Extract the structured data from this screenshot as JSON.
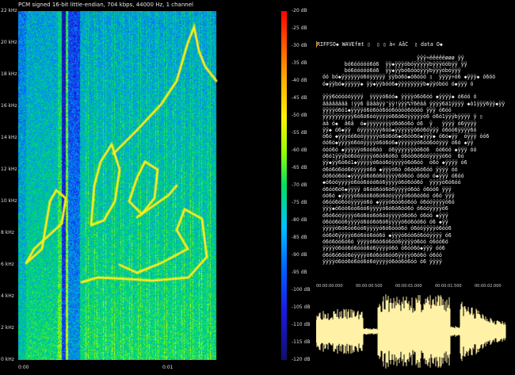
{
  "spectrogram": {
    "title": "PCM signed 16-bit little-endian, 704 kbps, 44000 Hz, 1 channel",
    "y_ticks": [
      "22 kHz",
      "20 kHz",
      "18 kHz",
      "16 kHz",
      "14 kHz",
      "12 kHz",
      "10 kHz",
      "8 kHz",
      "6 kHz",
      "4 kHz",
      "2 kHz",
      "0 kHz"
    ],
    "x_ticks": [
      "0:00",
      "0:01"
    ],
    "db_ticks": [
      "-20 dB",
      "-25 dB",
      "-30 dB",
      "-35 dB",
      "-40 dB",
      "-45 dB",
      "-50 dB",
      "-55 dB",
      "-60 dB",
      "-65 dB",
      "-70 dB",
      "-75 dB",
      "-80 dB",
      "-85 dB",
      "-90 dB",
      "-95 dB",
      "-100 dB",
      "-105 dB",
      "-110 dB",
      "-115 dB",
      "-120 dB"
    ],
    "colors": {
      "loud": "#ffff00",
      "mid": "#00e060",
      "quiet": "#1a1ae0"
    }
  },
  "hex_view": {
    "lines": [
      "RIFFŠÕ◆ WAVEfmt ▯  ▯ ▯ à« ÀåĈ  ▯ data Õ◆",
      "",
      "                                ÿÿÿ÷ëêéêëøøø ÿÿ",
      "         bó6óóóóó6ó6  ÿÿ◆ÿÿÿóbóÿÿÿÿÿbÿÿÿóóbÿÿ ÿÿ",
      "         bó6óóóóó6ó6  ÿÿ◆ÿÿbó6óòóÿÿÿbÿÿÿóbóÿÿÿ",
      "  óó bó◆ÿÿÿÿÿÿó6óÿÿÿÿÿ ÿÿbó6ó◆ó6óóó ▯  ÿÿÿÿ÷ó6 ◆ÿÿÿ◆ ó6óó",
      "  ó◆ÿÿbó◆ÿÿÿÿÿ◆ ÿÿ◆ÿÿbóó6◆ÿÿÿÿÿÿÿÿb◆ÿÿóbóó ó◆ÿÿÿ ó",
      "",
      "  ÿÿÿ6óóóóóÿÿÿÿ  ÿÿÿÿó6óó◆ ÿÿÿÿó6ó6óó ◆ÿÿÿÿ◆ ó6óó ó",
      "  ââââââââ (ÿÿ6 Ùâââÿÿ'ÿÿ!ÿÿÿ%Ÿ6ëäâ ÿÿÿÿ6ä1ÿÿÿÿ ◆ò1ÿÿÿ6ÿÿ◆ÿÿ",
      "  ÿÿÿÿó6ó1◆ÿÿÿÿó6ò6óó6óó6óóóó6óóóó ÿÿÿ ó6óó",
      "  ÿÿÿÿÿÿÿÿÿÿ6ó6ó6óóÿÿÿÿó66ó6óÿÿÿÿÿó6 ó6ó1ÿÿÿbÿÿÿÿ ÿ ▯",
      "  àâ ó◆  â6â  ó◆ÿÿÿÿÿÿÿÿó6ó6ó6ó ó6  ÿ   ÿÿÿÿ ó6ÿÿÿÿ",
      "  ÿÿ◆ ó6◆ÿÿ  óÿÿÿÿÿÿÿ6óó◆ÿÿÿÿÿÿó6ó6óÿÿÿ ó6óó6ÿÿÿÿ6ó",
      "  ó6ó ◆ÿÿÿóó6óóÿÿÿÿÿó6ó6ó6◆ó6óó6ó◆ÿÿÿ◆ ó6ó◆ÿÿ  óÿÿÿ óó6",
      "  óó6ó◆ÿÿÿÿó6óóÿÿÿÿó6ó6ó6◆ÿÿÿÿÿÿó6óó6óóÿÿÿ ó6ó ◆ÿÿ",
      "  óóó6ó ◆ÿÿÿÿÿó6óó6óó  ó6ÿÿÿÿÿÿóó6ó6  óó6óó ◆ÿÿÿ óó",
      "  ó6ó1ÿÿÿbó6óóÿÿÿÿó6óó6ó6ó ó6óó6ó6óóÿÿÿÿó6ó  6ó",
      "  ÿÿ◆ÿÿ6ó6ó1◆ÿÿÿÿÿó6óó6óÿÿÿÿó6ó6óó  ó6ó ◆ÿÿÿÿ ó6",
      "  ó6ó6ó6óó6óÿÿÿÿó6ó ◆ÿÿÿó6ó ó6óó6ó6óó ÿÿÿÿ óó",
      "  óó6óó6óó◆ÿÿÿÿó6ó6ó6óÿÿÿÿ6ó6óó ó6óó ó◆ÿÿÿ ó6óó",
      "  ◆ó6óóÿÿÿÿó6óó6óóó6ó6ÿÿÿÿó6ó6óó6ó  ÿÿÿÿó6ó6óó",
      "  ó6óó6ó6◆ÿÿÿÿ ó6óó6óó6ó6ÿÿÿÿó6óó ó6óó6 ÿÿÿ",
      "  óó6ó ◆ÿÿÿÿó6óóó6ó6ó6óóÿÿÿÿó6ó6óó6ó ó6ó ÿÿÿ",
      "  ó6óó6ó6óóÿÿÿÿó6ó ◆ÿÿÿó6óó6ó6óó ó6óóÿÿÿÿó6ó",
      "  ÿÿÿ◆ó6óó6óó6óó6ÿÿÿÿó6ó6ó6óó6ó ó6óóÿÿÿÿó6",
      "  ó6ó6óóÿÿÿÿó6ó6óó6ó6óóÿÿÿÿó6ó6ó ó6óó ◆ÿÿÿ",
      "  ó6óó6óó6ÿÿÿÿó6óó6ó6ó6ÿÿÿÿó6ó6óó6ó ó6 ◆ÿÿ",
      "  ÿÿÿÿó6ó6óó6óó6ÿÿÿÿó6ó6óóó6ó ó6óóÿÿÿÿó6óó6",
      "  óó6ó6ÿÿÿÿó6ó6óó6óó6ó ◆ÿÿÿó6óó6ó6óóÿÿÿÿ ó6",
      "  ó6ó6óó6ó6ó ÿÿÿÿó6óó6ó6óó6ÿÿÿÿó6óó ó6óó6ó",
      "  ÿÿÿÿó6óó6ó6óóó6ó6ÿÿÿÿó6ó ó6óó6ó◆ÿÿÿ óó6",
      "  ó6ó6ó6óó6óÿÿÿÿó6ó6óó6óó6ÿÿÿÿó6ó6ó ó6óó",
      "  ÿÿÿÿó6óó6ó6óó6ó6óÿÿÿÿó6óó6ó6óó ó6 ÿÿÿÿ"
    ]
  },
  "waveform": {
    "time_labels": [
      "00:00:00.000",
      "00:00:00.500",
      "00:00:01.000",
      "00:00:01.500",
      "00:00:02.000"
    ],
    "color": "#fff1a6"
  }
}
